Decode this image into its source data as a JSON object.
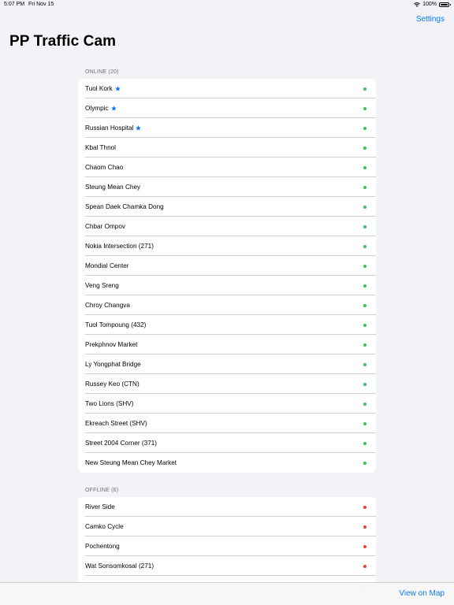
{
  "status_bar": {
    "time": "5:07 PM",
    "date": "Fri Nov 15",
    "battery": "100%",
    "battery_level": 1.0
  },
  "nav": {
    "settings_label": "Settings",
    "title": "PP Traffic Cam"
  },
  "colors": {
    "accent": "#0a7aff",
    "online": "#34c759",
    "offline": "#ff3b30"
  },
  "online": {
    "header": "ONLINE (20)",
    "items": [
      {
        "label": "Tuol Kork",
        "favorite": true
      },
      {
        "label": "Olympic",
        "favorite": true
      },
      {
        "label": "Russian Hospital",
        "favorite": true
      },
      {
        "label": "Kbal Thnol",
        "favorite": false
      },
      {
        "label": "Chaom Chao",
        "favorite": false
      },
      {
        "label": "Steung Mean Chey",
        "favorite": false
      },
      {
        "label": "Spean Daek Chamka Dong",
        "favorite": false
      },
      {
        "label": "Chbar Ompov",
        "favorite": false
      },
      {
        "label": "Nokia Intersection (271)",
        "favorite": false
      },
      {
        "label": "Mondial Center",
        "favorite": false
      },
      {
        "label": "Veng Sreng",
        "favorite": false
      },
      {
        "label": "Chroy Changva",
        "favorite": false
      },
      {
        "label": "Tuol Tompoung (432)",
        "favorite": false
      },
      {
        "label": "Prekphnov Market",
        "favorite": false
      },
      {
        "label": "Ly Yongphat Bridge",
        "favorite": false
      },
      {
        "label": "Russey Keo (CTN)",
        "favorite": false
      },
      {
        "label": "Two Lions (SHV)",
        "favorite": false
      },
      {
        "label": "Ekreach Street (SHV)",
        "favorite": false
      },
      {
        "label": "Street 2004 Corner (371)",
        "favorite": false
      },
      {
        "label": "New Steung Mean Chey Market",
        "favorite": false
      }
    ]
  },
  "offline": {
    "header": "OFFLINE (6)",
    "items": [
      {
        "label": "River Side",
        "favorite": false
      },
      {
        "label": "Camko Cycle",
        "favorite": false
      },
      {
        "label": "Pochentong",
        "favorite": false
      },
      {
        "label": "Wat Sonsomkosal (271)",
        "favorite": false
      },
      {
        "label": "",
        "favorite": false
      }
    ]
  },
  "toolbar": {
    "view_on_map_label": "View on Map"
  }
}
